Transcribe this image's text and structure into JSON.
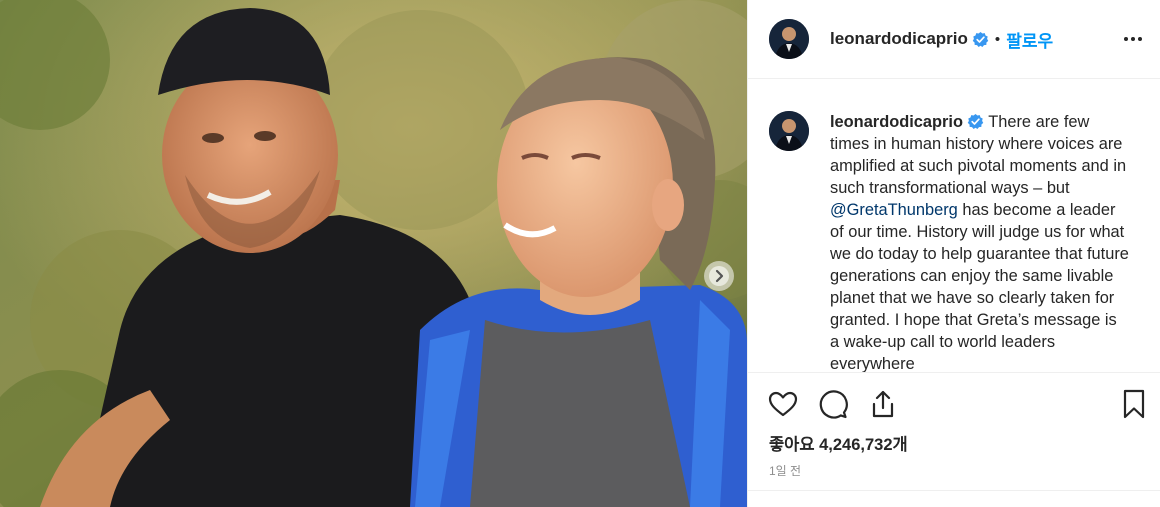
{
  "post": {
    "username": "leonardodicaprio",
    "follow_label": "팔로우",
    "separator": "•",
    "caption": {
      "username": "leonardodicaprio",
      "text_before_mention": " There are few times in human history where voices are amplified at such pivotal moments and in such transformational ways – but ",
      "mention": "@GretaThunberg",
      "text_after_mention": " has become a leader of our time. History will judge us for what we do today to help guarantee that future generations can enjoy the same livable planet that we have so clearly taken for granted. I hope that Greta’s message is a wake-up call to world leaders everywhere"
    },
    "likes_label": "좋아요 4,246,732개",
    "timestamp": "1일 전"
  },
  "icons": {
    "verified": "verified-badge-icon",
    "more": "more-options-icon",
    "like": "heart-icon",
    "comment": "comment-icon",
    "share": "share-icon",
    "save": "bookmark-icon",
    "carousel_next": "chevron-right-icon"
  },
  "colors": {
    "accent": "#0095f6",
    "text": "#262626",
    "muted": "#8e8e8e",
    "border": "#efefef",
    "mention": "#00376b"
  }
}
